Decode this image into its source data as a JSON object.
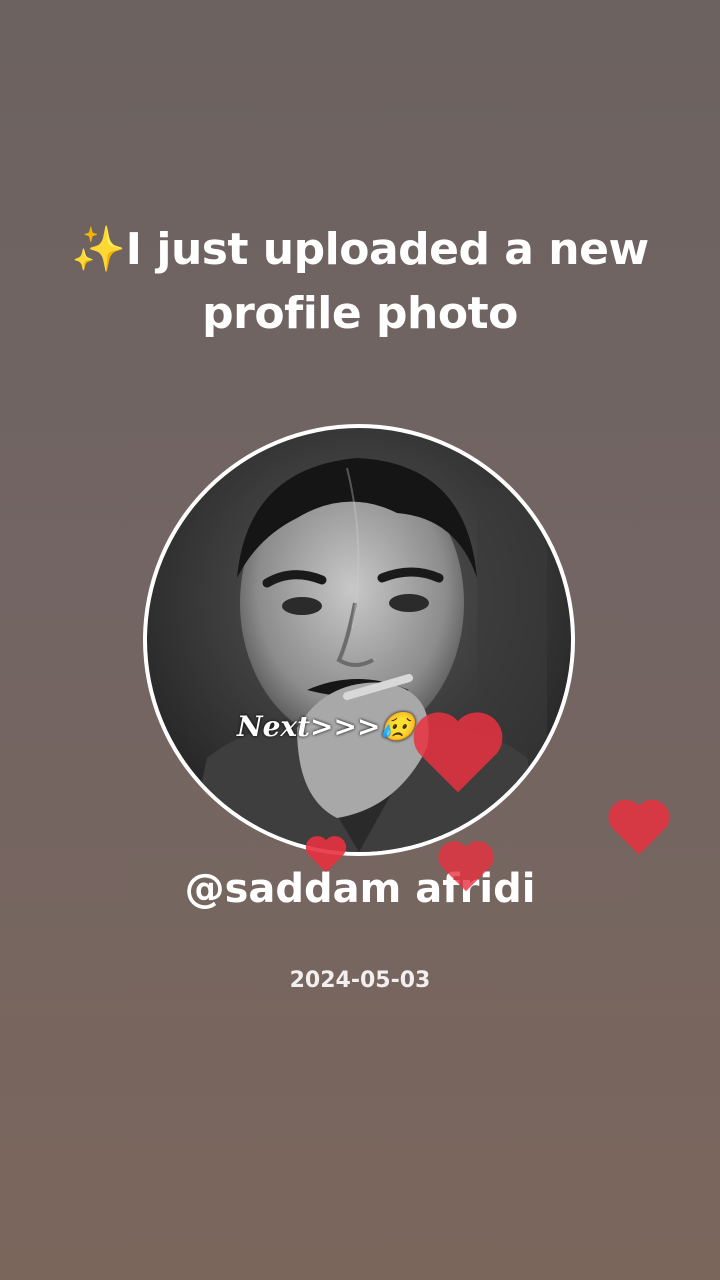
{
  "header": {
    "sparkle_emoji": "✨",
    "title": "I just uploaded a new profile photo"
  },
  "profile": {
    "photo_caption": "Next>>>😥",
    "username": "@saddam afridi",
    "date": "2024-05-03"
  },
  "decorations": {
    "heart_color": "#e8313f",
    "heart_icon": "heart-icon"
  }
}
